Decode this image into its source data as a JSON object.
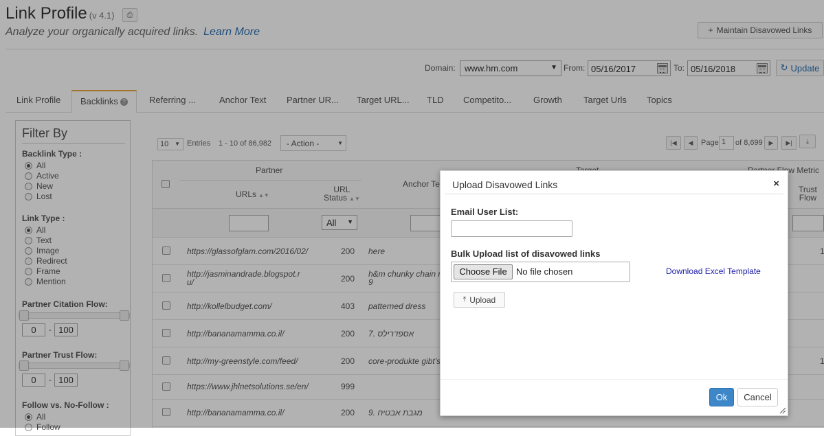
{
  "header": {
    "title": "Link Profile",
    "version": "(v 4.1)",
    "subtitle": "Analyze your organically acquired links.",
    "learn_more": "Learn More",
    "maintain_btn": "Maintain Disavowed Links"
  },
  "domain_bar": {
    "domain_label": "Domain:",
    "domain_value": "www.hm.com",
    "from_label": "From:",
    "from_value": "05/16/2017",
    "to_label": "To:",
    "to_value": "05/16/2018",
    "update_label": "Update"
  },
  "tabs": [
    {
      "label": "Link Profile"
    },
    {
      "label": "Backlinks"
    },
    {
      "label": "Referring ..."
    },
    {
      "label": "Anchor Text"
    },
    {
      "label": "Partner UR..."
    },
    {
      "label": "Target URL..."
    },
    {
      "label": "TLD"
    },
    {
      "label": "Competito..."
    },
    {
      "label": "Growth"
    },
    {
      "label": "Target Urls"
    },
    {
      "label": "Topics"
    }
  ],
  "filter": {
    "title": "Filter By",
    "backlink_type": {
      "heading": "Backlink Type :",
      "options": [
        "All",
        "Active",
        "New",
        "Lost"
      ]
    },
    "link_type": {
      "heading": "Link Type :",
      "options": [
        "All",
        "Text",
        "Image",
        "Redirect",
        "Frame",
        "Mention"
      ]
    },
    "citation_flow": {
      "heading": "Partner Citation Flow:",
      "min": "0",
      "max": "100"
    },
    "trust_flow": {
      "heading": "Partner Trust Flow:",
      "min": "0",
      "max": "100"
    },
    "follow": {
      "heading": "Follow vs. No-Follow :",
      "options": [
        "All",
        "Follow"
      ]
    },
    "dash": "-"
  },
  "table_controls": {
    "entries_value": "10",
    "entries_label": "Entries",
    "range_text": "1 - 10 of 86,982",
    "action_label": "- Action -",
    "page_label": "Page",
    "page_value": "1",
    "page_of": "of 8,699"
  },
  "table": {
    "group_partner": "Partner",
    "group_target": "Target",
    "group_flow": "Partner Flow Metric",
    "col_urls": "URLs",
    "col_status_1": "URL",
    "col_status_2": "Status",
    "col_anchor": "Anchor Te",
    "col_trust_1": "Trust",
    "col_trust_2": "Flow",
    "status_filter": "All",
    "rows": [
      {
        "url": "https://glassofglam.com/2016/02/",
        "status": "200",
        "anchor": "here",
        "extra": "1"
      },
      {
        "url": "http://jasminandrade.blogspot.r",
        "url2": "u/",
        "status": "200",
        "anchor": "h&m chunky chain n",
        "anchor2": "9",
        "extra": ""
      },
      {
        "url": "http://kollelbudget.com/",
        "status": "403",
        "anchor": "patterned dress",
        "extra": ""
      },
      {
        "url": "http://bananamamma.co.il/",
        "status": "200",
        "anchor": "7. אספדרילס",
        "extra": ""
      },
      {
        "url": "http://my-greenstyle.com/feed/",
        "status": "200",
        "anchor": "core-produkte gibt's",
        "extra": "1"
      },
      {
        "url": "https://www.jhlnetsolutions.se/en/",
        "status": "999",
        "anchor": "",
        "extra": ""
      },
      {
        "url": "http://bananamamma.co.il/",
        "status": "200",
        "anchor": "9. מגבת אבטיח",
        "extra": ""
      }
    ]
  },
  "modal": {
    "title": "Upload Disavowed Links",
    "close": "×",
    "email_label": "Email User List:",
    "bulk_label": "Bulk Upload list of disavowed links",
    "choose_file": "Choose File",
    "no_file": "No file chosen",
    "download_link": "Download Excel Template",
    "upload_btn": "Upload",
    "ok_btn": "Ok",
    "cancel_btn": "Cancel"
  },
  "colors": {
    "accent_tab": "#e5a63a",
    "link": "#2a6fb0",
    "primary_button": "#3d87c9"
  }
}
